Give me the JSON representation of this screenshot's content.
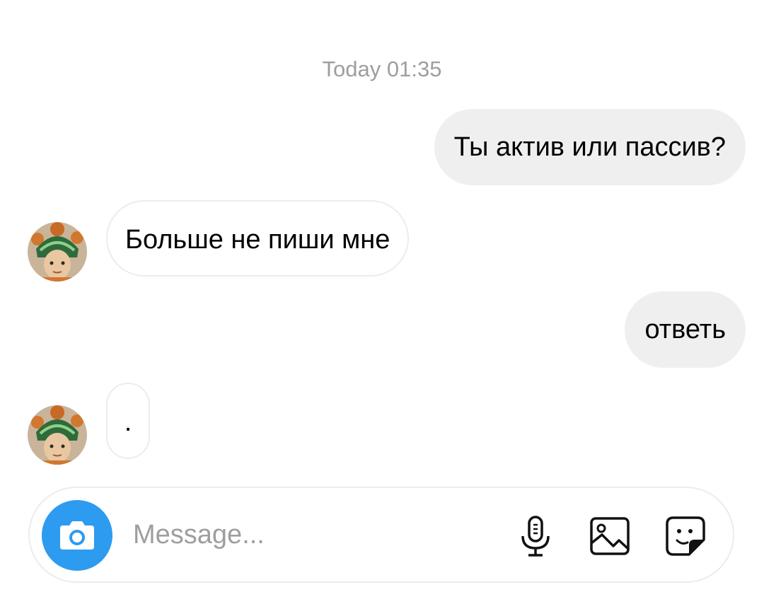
{
  "chat": {
    "timestamp": "Today 01:35",
    "messages": [
      {
        "direction": "outgoing",
        "text": "Ты актив или пассив?"
      },
      {
        "direction": "incoming",
        "text": "Больше не пиши мне"
      },
      {
        "direction": "outgoing",
        "text": "ответь"
      },
      {
        "direction": "incoming",
        "text": "."
      }
    ]
  },
  "composer": {
    "placeholder": "Message...",
    "icons": [
      "camera-icon",
      "microphone-icon",
      "gallery-icon",
      "sticker-icon"
    ]
  },
  "colors": {
    "accent": "#2d9bf0",
    "outgoing_bubble": "#efefef",
    "incoming_border": "#ececec",
    "muted_text": "#9e9e9e"
  }
}
